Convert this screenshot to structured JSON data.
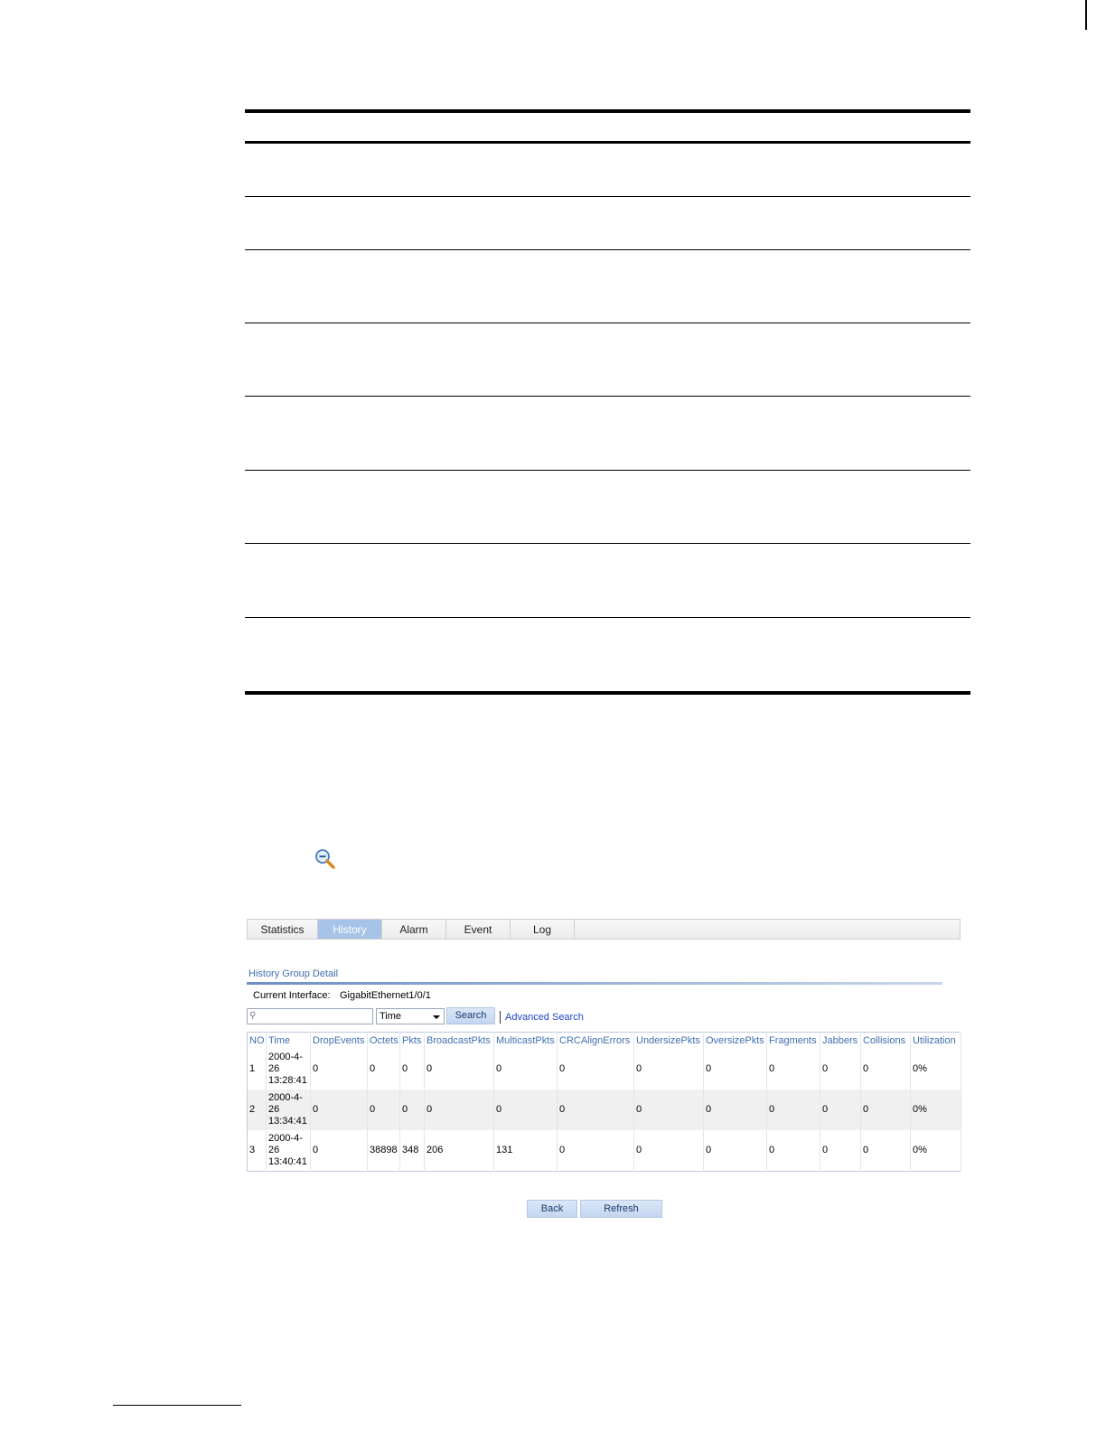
{
  "tabs": [
    {
      "label": "Statistics",
      "active": false
    },
    {
      "label": "History",
      "active": true
    },
    {
      "label": "Alarm",
      "active": false
    },
    {
      "label": "Event",
      "active": false
    },
    {
      "label": "Log",
      "active": false
    }
  ],
  "section_title": "History Group Detail",
  "interface": {
    "label": "Current Interface:",
    "value": "GigabitEthernet1/0/1"
  },
  "search": {
    "placeholder": "",
    "field": "Time",
    "search_label": "Search",
    "advanced_label": "Advanced Search"
  },
  "table": {
    "columns": [
      "NO",
      "Time",
      "DropEvents",
      "Octets",
      "Pkts",
      "BroadcastPkts",
      "MulticastPkts",
      "CRCAlignErrors",
      "UndersizePkts",
      "OversizePkts",
      "Fragments",
      "Jabbers",
      "Collisions",
      "Utilization"
    ],
    "rows": [
      {
        "no": "1",
        "time": [
          "2000-4-",
          "26",
          "13:28:41"
        ],
        "cells": [
          "0",
          "0",
          "0",
          "0",
          "0",
          "0",
          "0",
          "0",
          "0",
          "0",
          "0",
          "0%"
        ]
      },
      {
        "no": "2",
        "time": [
          "2000-4-",
          "26",
          "13:34:41"
        ],
        "cells": [
          "0",
          "0",
          "0",
          "0",
          "0",
          "0",
          "0",
          "0",
          "0",
          "0",
          "0",
          "0%"
        ]
      },
      {
        "no": "3",
        "time": [
          "2000-4-",
          "26",
          "13:40:41"
        ],
        "cells": [
          "0",
          "38898",
          "348",
          "206",
          "131",
          "0",
          "0",
          "0",
          "0",
          "0",
          "0",
          "0%"
        ]
      }
    ]
  },
  "buttons": {
    "back": "Back",
    "refresh": "Refresh"
  },
  "icons": {
    "zoom": "zoom-out-magnifier-icon"
  },
  "colors": {
    "accent": "#3f6fb0",
    "active_tab": "#a6c3e8",
    "link": "#2046c8"
  }
}
